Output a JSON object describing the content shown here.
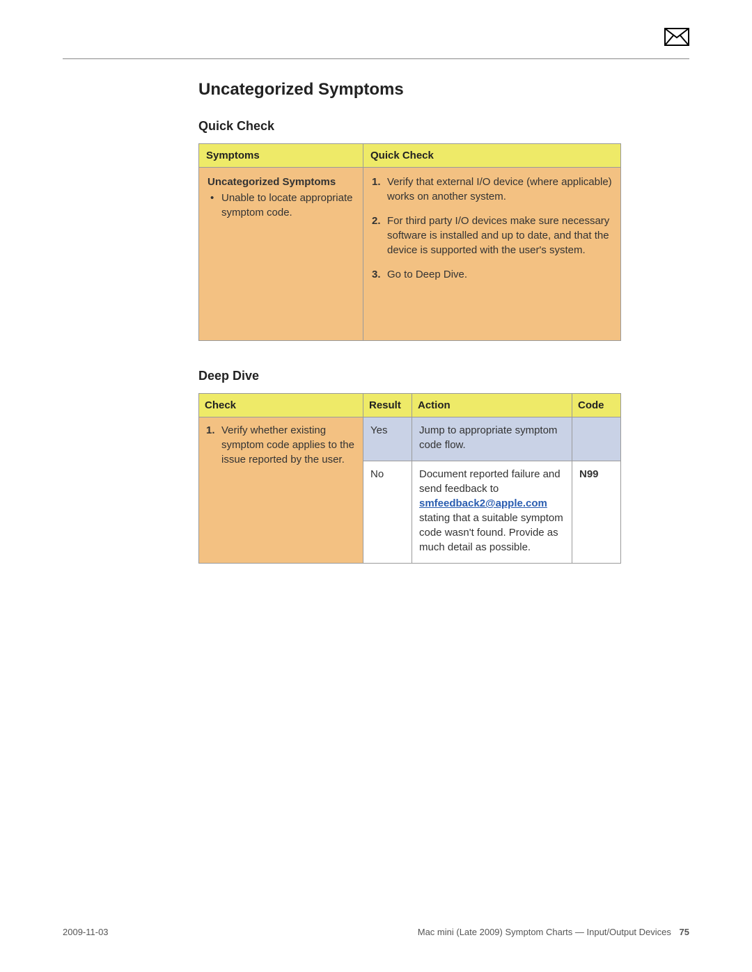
{
  "page": {
    "heading": "Uncategorized Symptoms",
    "quick_check_heading": "Quick Check",
    "deep_dive_heading": "Deep Dive"
  },
  "quick_check": {
    "headers": {
      "symptoms": "Symptoms",
      "quick_check": "Quick Check"
    },
    "symptoms_title": "Uncategorized Symptoms",
    "symptom_bullets": [
      "Unable to locate appropriate symptom code."
    ],
    "steps": [
      "Verify that external I/O device (where applicable) works on another system.",
      "For third party I/O devices make sure necessary software is installed and up to date, and that the device is supported with the user's system.",
      "Go to Deep Dive."
    ]
  },
  "deep_dive": {
    "headers": {
      "check": "Check",
      "result": "Result",
      "action": "Action",
      "code": "Code"
    },
    "check_text": "Verify whether existing symptom code applies to the issue reported by the user.",
    "rows": [
      {
        "result": "Yes",
        "action_plain": "Jump to appropriate symptom code flow.",
        "code": ""
      },
      {
        "result": "No",
        "action_pre": "Document reported failure and send feedback to ",
        "action_link": "smfeedback2@apple.com",
        "action_post": " stating that a suitable symptom code wasn't found. Provide as much detail as possible.",
        "code": "N99"
      }
    ]
  },
  "footer": {
    "date": "2009-11-03",
    "doc_title": "Mac mini (Late 2009) Symptom Charts — Input/Output Devices",
    "page_number": "75"
  }
}
